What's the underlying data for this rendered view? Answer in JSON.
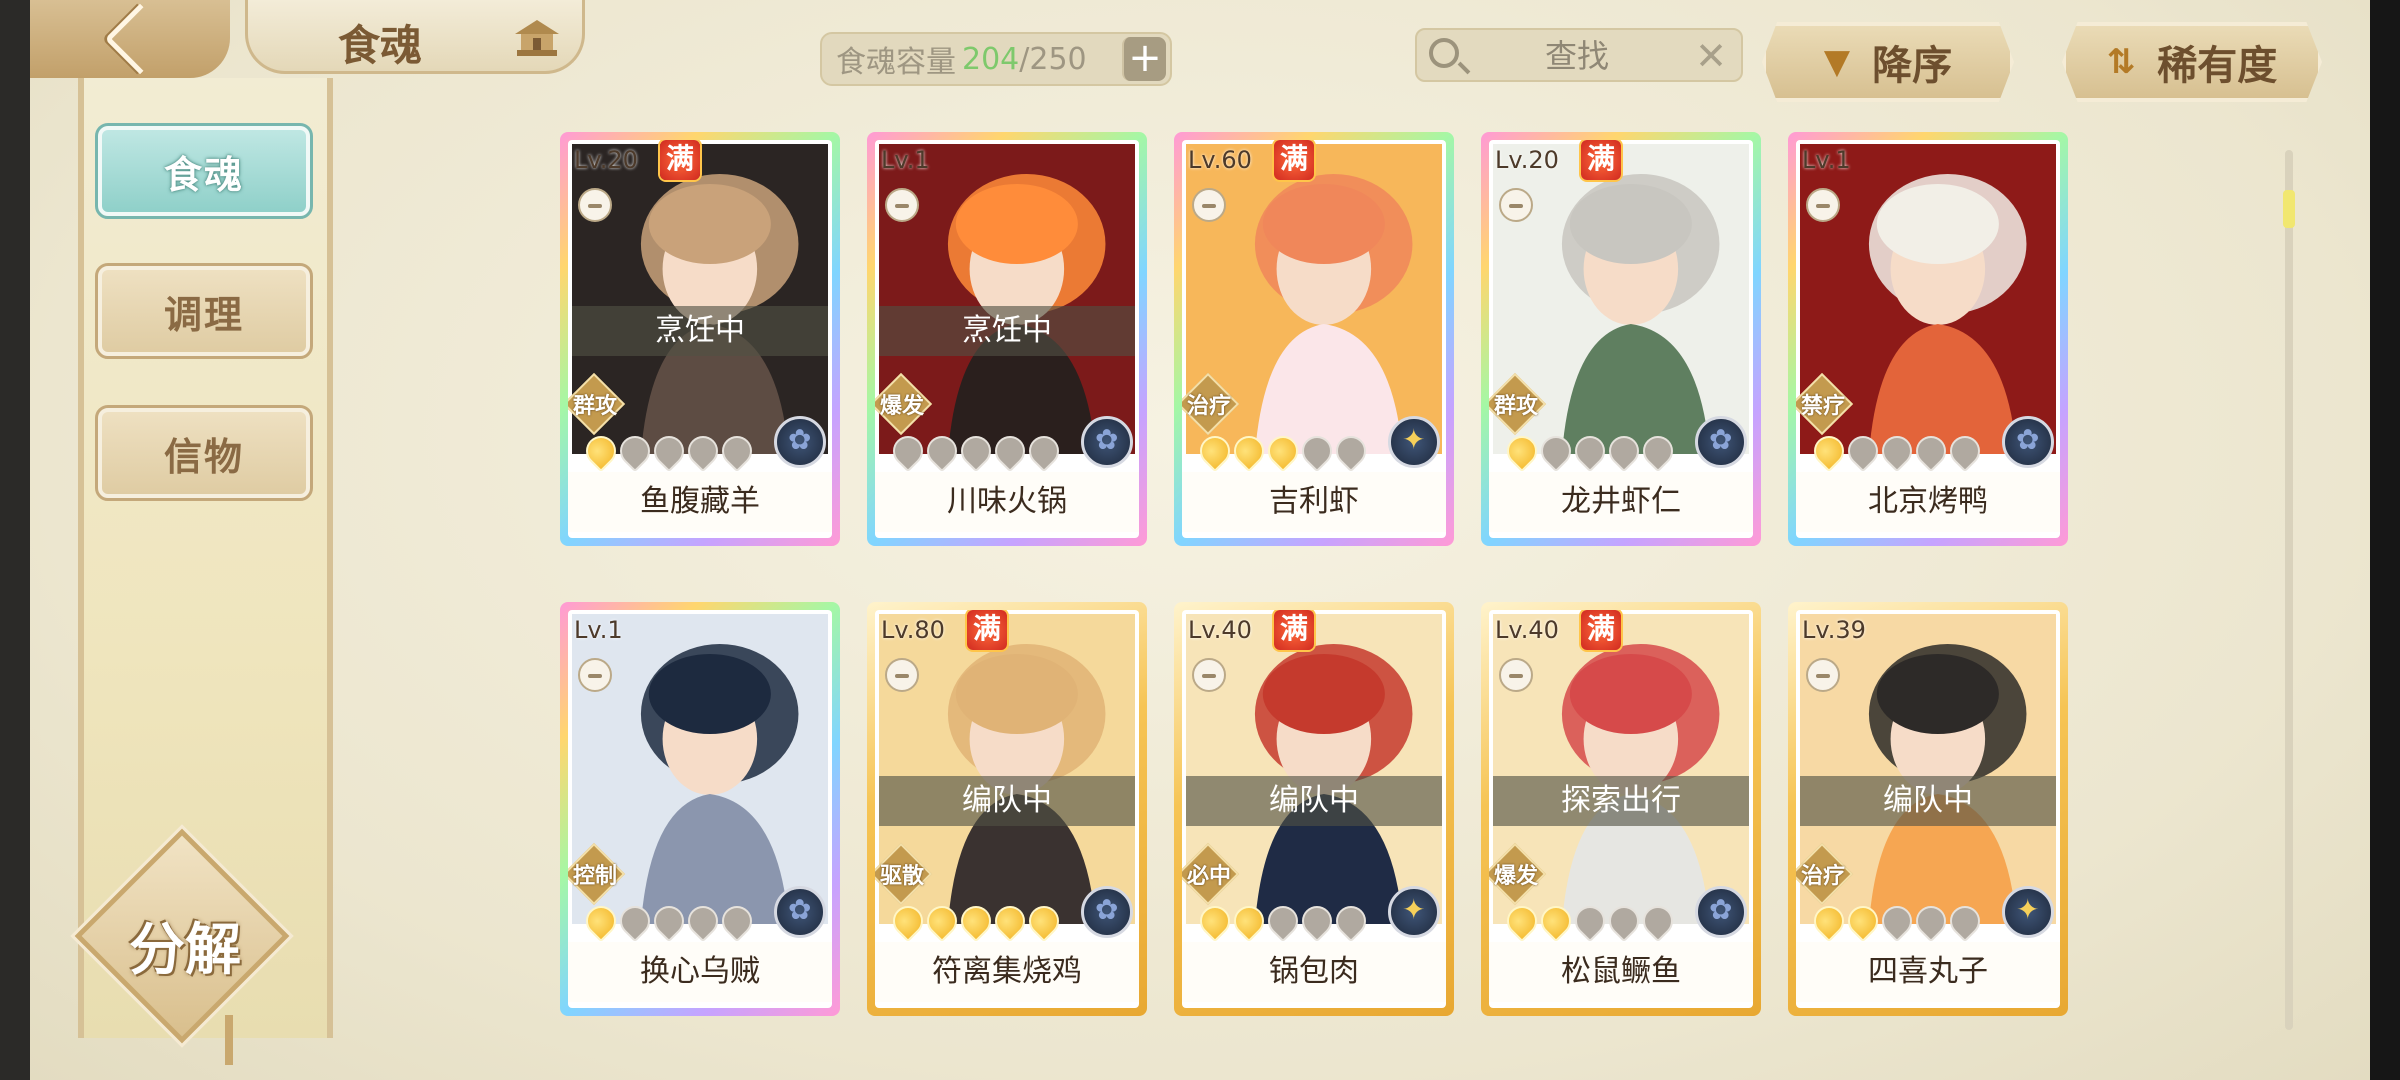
{
  "header": {
    "title": "食魂"
  },
  "sidebar": {
    "items": [
      {
        "label": "食魂",
        "active": true
      },
      {
        "label": "调理",
        "active": false
      },
      {
        "label": "信物",
        "active": false
      }
    ],
    "decompose_label": "分解"
  },
  "capacity": {
    "label": "食魂容量",
    "current": "204",
    "max": "/250"
  },
  "search": {
    "placeholder": "查找"
  },
  "sort": {
    "order_label": "降序",
    "key_label": "稀有度"
  },
  "colors": {
    "accent_teal": "#8fd0c9",
    "gold": "#c39a4e",
    "capacity_green": "#7ec96c"
  },
  "cards": [
    {
      "level": "Lv.20",
      "full": "满",
      "status": "烹饪中",
      "role": "群攻",
      "stars": 1,
      "name": "鱼腹藏羊",
      "frame": "rainbow",
      "element": "blue",
      "palette": [
        "#2b2523",
        "#5d4c43",
        "#c9a27a"
      ]
    },
    {
      "level": "Lv.1",
      "full": "",
      "status": "烹饪中",
      "role": "爆发",
      "stars": 0,
      "name": "川味火锅",
      "frame": "rainbow",
      "element": "blue",
      "palette": [
        "#7c1a1a",
        "#2a1f1d",
        "#ff8c3a"
      ]
    },
    {
      "level": "Lv.60",
      "full": "满",
      "status": "",
      "role": "治疗",
      "stars": 3,
      "name": "吉利虾",
      "frame": "rainbow",
      "element": "gold",
      "palette": [
        "#f7b75a",
        "#fbe6e9",
        "#f0875a"
      ]
    },
    {
      "level": "Lv.20",
      "full": "满",
      "status": "",
      "role": "群攻",
      "stars": 1,
      "name": "龙井虾仁",
      "frame": "rainbow",
      "element": "blue",
      "palette": [
        "#eef0ea",
        "#5f7f60",
        "#c8c6c0"
      ]
    },
    {
      "level": "Lv.1",
      "full": "",
      "status": "",
      "role": "禁疗",
      "stars": 1,
      "name": "北京烤鸭",
      "frame": "rainbow",
      "element": "blue",
      "palette": [
        "#8e1a18",
        "#e3643a",
        "#f2efe7"
      ]
    },
    {
      "level": "Lv.1",
      "full": "",
      "status": "",
      "role": "控制",
      "stars": 1,
      "name": "换心乌贼",
      "frame": "rainbow",
      "element": "blue",
      "palette": [
        "#dfe6ef",
        "#8b96ae",
        "#1d2a3f"
      ]
    },
    {
      "level": "Lv.80",
      "full": "满",
      "status": "编队中",
      "role": "驱散",
      "stars": 5,
      "name": "符离集烧鸡",
      "frame": "gold",
      "element": "blue",
      "palette": [
        "#f5d99b",
        "#3a3230",
        "#e0b376"
      ]
    },
    {
      "level": "Lv.40",
      "full": "满",
      "status": "编队中",
      "role": "必中",
      "stars": 2,
      "name": "锅包肉",
      "frame": "gold",
      "element": "gold",
      "palette": [
        "#f7e4b8",
        "#1f2b45",
        "#c53a2d"
      ]
    },
    {
      "level": "Lv.40",
      "full": "满",
      "status": "探索出行",
      "role": "爆发",
      "stars": 2,
      "name": "松鼠鳜鱼",
      "frame": "gold",
      "element": "blue",
      "palette": [
        "#f7e4b8",
        "#e6e6e2",
        "#d64a4a"
      ]
    },
    {
      "level": "Lv.39",
      "full": "",
      "status": "编队中",
      "role": "治疗",
      "stars": 2,
      "name": "四喜丸子",
      "frame": "gold",
      "element": "gold",
      "palette": [
        "#f7d9a4",
        "#f6a652",
        "#2d2a28"
      ]
    }
  ]
}
